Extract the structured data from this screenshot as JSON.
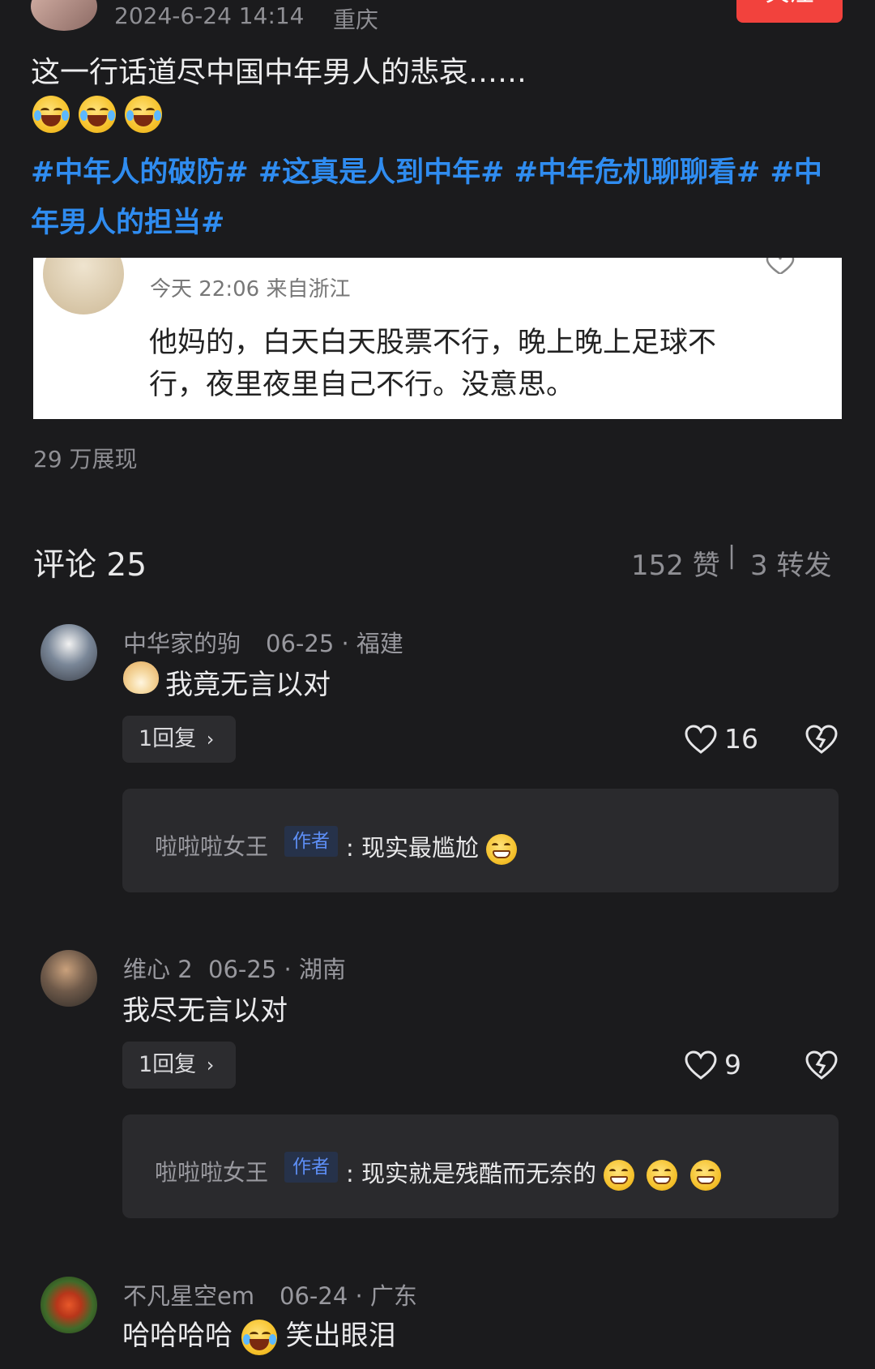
{
  "post": {
    "timestamp": "2024-6-24 14:14",
    "location": "重庆",
    "follow_label": "关注",
    "text": "这一行话道尽中国中年男人的悲哀……",
    "hashtags_line1": "#中年人的破防# #这真是人到中年# #中年危机聊聊看# #中",
    "hashtags_line2": "年男人的担当#",
    "impressions": "29 万展现"
  },
  "embedded_screenshot": {
    "meta": "今天 22:06 来自浙江",
    "line1": "他妈的，白天白天股票不行，晚上晚上足球不",
    "line2": "行，夜里夜里自己不行。没意思。"
  },
  "comments_header": {
    "title": "评论 25",
    "likes": "152 赞",
    "separator": "|",
    "shares": "3 转发"
  },
  "comments": [
    {
      "user": "中华家的驹",
      "meta": "06-25 · 福建",
      "text": "我竟无言以对",
      "reply_btn": "1回复",
      "likes": "16",
      "reply": {
        "user": "啦啦啦女王",
        "tag": "作者",
        "text": ": 现实最尴尬"
      }
    },
    {
      "user": "维心 2",
      "meta": "06-25 · 湖南",
      "text": "我尽无言以对",
      "reply_btn": "1回复",
      "likes": "9",
      "reply": {
        "user": "啦啦啦女王",
        "tag": "作者",
        "text": ": 现实就是残酷而无奈的"
      }
    },
    {
      "user": "不凡星空em",
      "meta": "06-24 · 广东",
      "text_a": "哈哈哈哈",
      "text_b": "笑出眼泪"
    }
  ],
  "colors": {
    "background": "#1b1b1d",
    "hashtag": "#2f8cf0",
    "follow": "#f2423d",
    "author_tag": "#5d8ef5"
  }
}
